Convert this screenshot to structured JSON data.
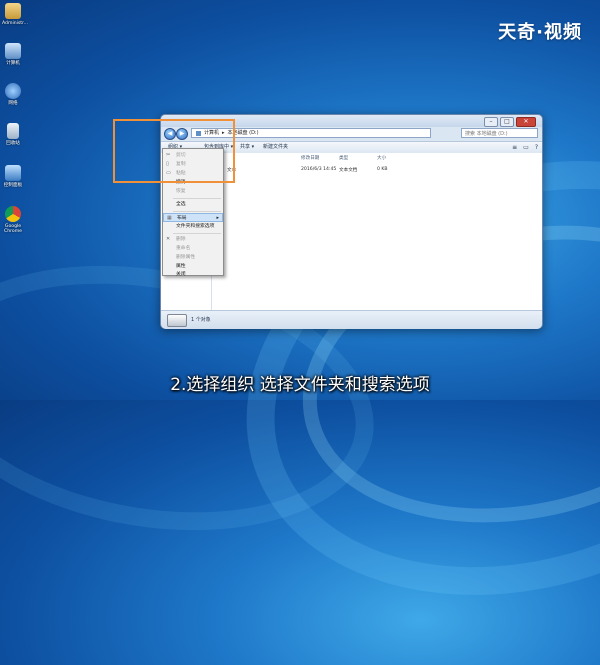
{
  "watermark": "天奇·视频",
  "desktop_icons": [
    {
      "label": "Administr...",
      "icon": "folder-user-icon",
      "color": "#d9b45a"
    },
    {
      "label": "计算机",
      "icon": "computer-icon",
      "color": "#8fb9e6"
    },
    {
      "label": "网络",
      "icon": "network-icon",
      "color": "#6fa8dd"
    },
    {
      "label": "回收站",
      "icon": "recycle-bin-icon",
      "color": "#c9d6e6"
    },
    {
      "label": "控制面板",
      "icon": "control-panel-icon",
      "color": "#4f8fd0"
    },
    {
      "label": "Google Chrome",
      "icon": "chrome-icon",
      "color": "#e8b23a"
    }
  ],
  "window": {
    "controls": [
      "–",
      "□",
      "✕"
    ],
    "address": {
      "crumbs": [
        "计算机",
        "本地磁盘 (D:)"
      ]
    },
    "search_placeholder": "搜索 本地磁盘 (D:)",
    "toolbar": {
      "organize": "组织 ▾",
      "include_library": "包含到库中 ▾",
      "share": "共享 ▾",
      "new_folder": "新建文件夹"
    },
    "columns": [
      "修改日期",
      "类型",
      "大小"
    ],
    "file": {
      "name": "文本",
      "date": "2016/6/3 14:45",
      "type": "文本文档",
      "size": "0 KB"
    },
    "status": "1 个对象"
  },
  "menu": {
    "items": [
      {
        "label": "剪切",
        "icon": "scissors-icon",
        "disabled": true
      },
      {
        "label": "复制",
        "icon": "copy-icon",
        "disabled": true
      },
      {
        "label": "粘贴",
        "icon": "paste-icon",
        "disabled": true
      },
      {
        "label": "撤消",
        "icon": "",
        "disabled": false
      },
      {
        "label": "恢复",
        "icon": "",
        "disabled": true
      },
      {
        "label": "全选",
        "icon": "",
        "disabled": false
      },
      {
        "label": "布局",
        "icon": "layout-icon",
        "disabled": false,
        "submenu": true
      },
      {
        "label": "文件夹和搜索选项",
        "icon": "",
        "disabled": false
      },
      {
        "label": "删除",
        "icon": "delete-icon",
        "disabled": true
      },
      {
        "label": "重命名",
        "icon": "",
        "disabled": true
      },
      {
        "label": "删除属性",
        "icon": "",
        "disabled": true
      },
      {
        "label": "属性",
        "icon": "",
        "disabled": false
      },
      {
        "label": "关闭",
        "icon": "",
        "disabled": false
      }
    ]
  },
  "subtitle": "2.选择组织  选择文件夹和搜索选项"
}
